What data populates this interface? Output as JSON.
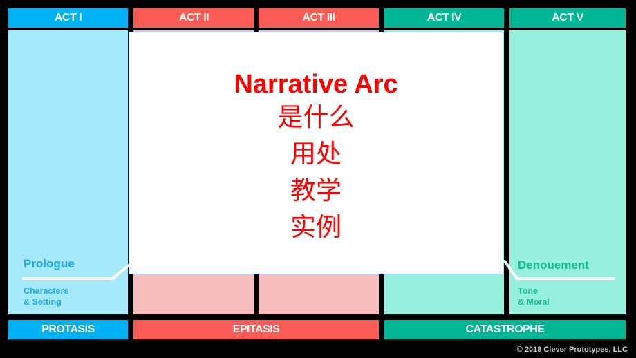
{
  "acts": [
    {
      "label": "ACT I",
      "color": "#00b1f3"
    },
    {
      "label": "ACT II",
      "color": "#fa5b55"
    },
    {
      "label": "ACT III",
      "color": "#fa5b55"
    },
    {
      "label": "ACT IV",
      "color": "#00b694"
    },
    {
      "label": "ACT V",
      "color": "#00b694"
    }
  ],
  "stages": [
    {
      "label": "PROTASIS",
      "color": "#00b1f3"
    },
    {
      "label": "EPITASIS",
      "color": "#fa5b55"
    },
    {
      "label": "CATASTROPHE",
      "color": "#00b694"
    }
  ],
  "prologue": {
    "title": "Prologue",
    "sub1": "Characters",
    "sub2": "& Setting",
    "color": "#1fa9ee"
  },
  "denouement": {
    "title": "Denouement",
    "sub1": "Tone",
    "sub2": "& Moral",
    "color": "#17b990"
  },
  "overlay": {
    "title": "Narrative Arc",
    "lines": [
      "是什么",
      "用处",
      "教学",
      "实例"
    ],
    "text_color": "#ff0000"
  },
  "copyright": "© 2018 Clever Prototypes, LLC"
}
